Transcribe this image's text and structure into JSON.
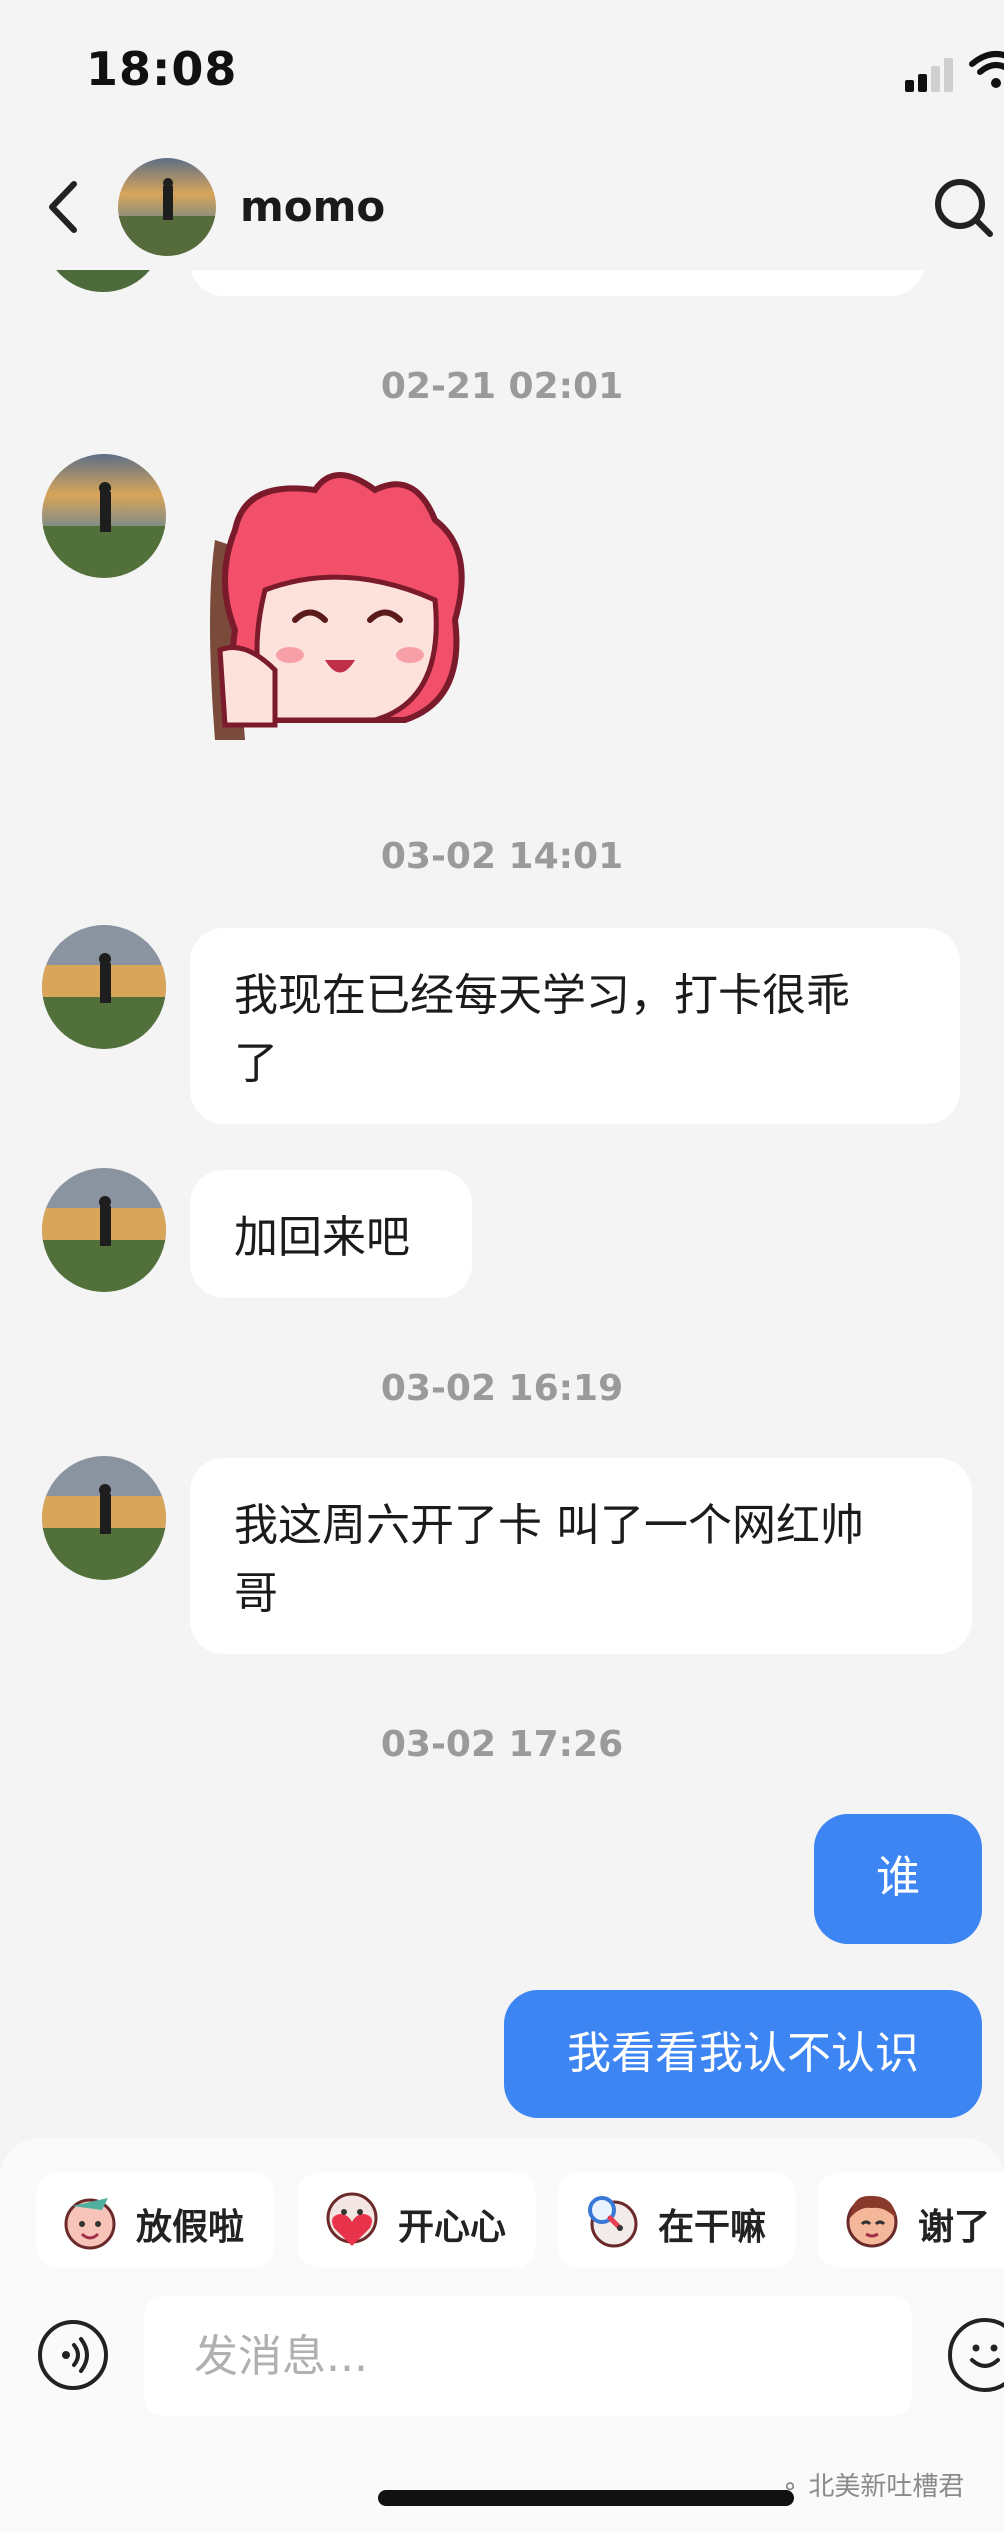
{
  "status_bar": {
    "time": "18:08"
  },
  "header": {
    "contact_name": "momo",
    "avatar_icon": "landscape-avatar",
    "back_icon": "chevron-left-icon",
    "search_icon": "search-icon"
  },
  "messages": [
    {
      "timestamp": "02-21 02:01",
      "type": "sticker",
      "sender": "momo",
      "sticker_icon": "pink-hair-girl-sticker"
    },
    {
      "timestamp": "03-02 14:01",
      "type": "text",
      "sender": "momo",
      "line1": "我现在已经每天学习，打卡很乖",
      "line2": "了"
    },
    {
      "type": "text",
      "sender": "momo",
      "text": "加回来吧"
    },
    {
      "timestamp": "03-02 16:19",
      "type": "text",
      "sender": "momo",
      "line1": "我这周六开了卡 叫了一个网红帅",
      "line2": "哥"
    },
    {
      "timestamp": "03-02 17:26",
      "type": "text",
      "sender": "me",
      "text": "谁"
    },
    {
      "type": "text",
      "sender": "me",
      "text": "我看看我认不认识"
    }
  ],
  "quick_replies": [
    {
      "label": "放假啦",
      "icon": "party-face-sticker-icon"
    },
    {
      "label": "开心心",
      "icon": "heart-hug-sticker-icon"
    },
    {
      "label": "在干嘛",
      "icon": "magnifier-sticker-icon"
    },
    {
      "label": "谢了",
      "icon": "shy-face-sticker-icon"
    }
  ],
  "composer": {
    "placeholder": "发消息...",
    "voice_icon": "voice-icon",
    "emoji_icon": "emoji-icon"
  },
  "watermark": "北美新吐槽君",
  "colors": {
    "accent": "#3c85f2",
    "background": "#f4f4f4"
  }
}
